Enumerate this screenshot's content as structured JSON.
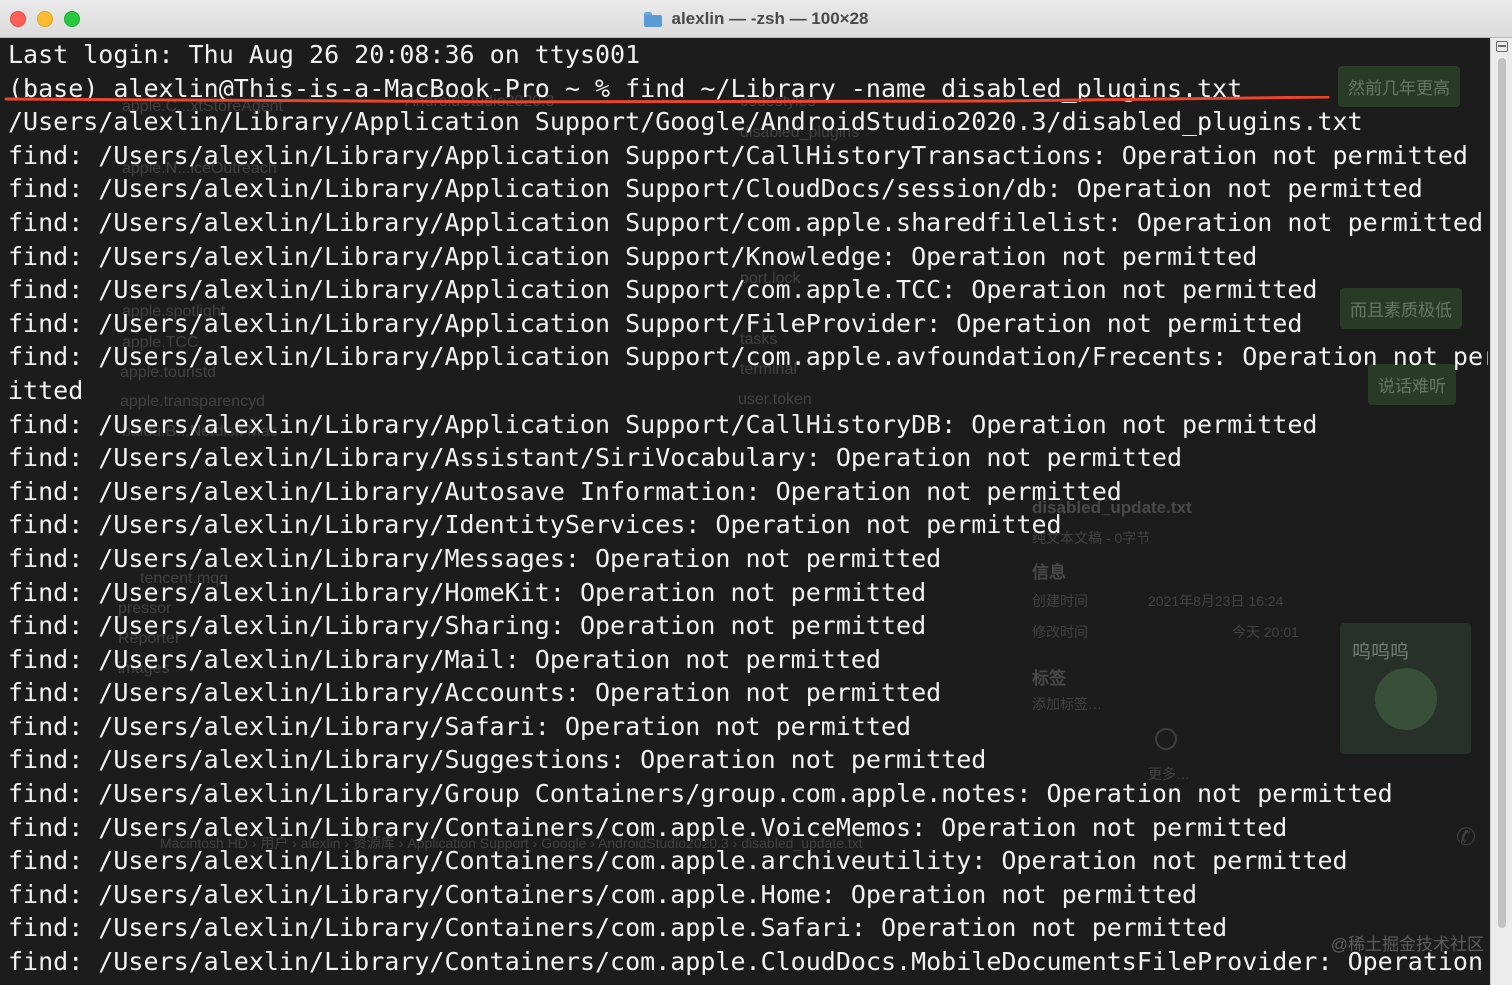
{
  "window": {
    "title": "alexlin — -zsh — 100×28",
    "folder_icon": "folder-icon"
  },
  "terminal": {
    "lines": [
      "Last login: Thu Aug 26 20:08:36 on ttys001",
      "(base) alexlin@This-is-a-MacBook-Pro ~ % find ~/Library -name disabled_plugins.txt",
      "/Users/alexlin/Library/Application Support/Google/AndroidStudio2020.3/disabled_plugins.txt",
      "find: /Users/alexlin/Library/Application Support/CallHistoryTransactions: Operation not permitted",
      "find: /Users/alexlin/Library/Application Support/CloudDocs/session/db: Operation not permitted",
      "find: /Users/alexlin/Library/Application Support/com.apple.sharedfilelist: Operation not permitted",
      "find: /Users/alexlin/Library/Application Support/Knowledge: Operation not permitted",
      "find: /Users/alexlin/Library/Application Support/com.apple.TCC: Operation not permitted",
      "find: /Users/alexlin/Library/Application Support/FileProvider: Operation not permitted",
      "find: /Users/alexlin/Library/Application Support/com.apple.avfoundation/Frecents: Operation not perm",
      "itted",
      "find: /Users/alexlin/Library/Application Support/CallHistoryDB: Operation not permitted",
      "find: /Users/alexlin/Library/Assistant/SiriVocabulary: Operation not permitted",
      "find: /Users/alexlin/Library/Autosave Information: Operation not permitted",
      "find: /Users/alexlin/Library/IdentityServices: Operation not permitted",
      "find: /Users/alexlin/Library/Messages: Operation not permitted",
      "find: /Users/alexlin/Library/HomeKit: Operation not permitted",
      "find: /Users/alexlin/Library/Sharing: Operation not permitted",
      "find: /Users/alexlin/Library/Mail: Operation not permitted",
      "find: /Users/alexlin/Library/Accounts: Operation not permitted",
      "find: /Users/alexlin/Library/Safari: Operation not permitted",
      "find: /Users/alexlin/Library/Suggestions: Operation not permitted",
      "find: /Users/alexlin/Library/Group Containers/group.com.apple.notes: Operation not permitted",
      "find: /Users/alexlin/Library/Containers/com.apple.VoiceMemos: Operation not permitted",
      "find: /Users/alexlin/Library/Containers/com.apple.archiveutility: Operation not permitted",
      "find: /Users/alexlin/Library/Containers/com.apple.Home: Operation not permitted",
      "find: /Users/alexlin/Library/Containers/com.apple.Safari: Operation not permitted",
      "find: /Users/alexlin/Library/Containers/com.apple.CloudDocs.MobileDocumentsFileProvider: Operation n"
    ],
    "annotation_color": "#e8452c"
  },
  "background": {
    "finder_items": [
      "apple.C...xtStoreAgent",
      "AndroidStudio2020.3",
      "codestyles",
      "disabled_plugins",
      "apple.N...iceOutreach",
      "apple.spotlight",
      "apple.TCC",
      "tasks",
      "terminal",
      "apple.touristd",
      "apple.transparencyd",
      "user.token",
      "baidu.B...Netdisk Mac",
      "tencent.mqq",
      "pressor",
      "Reporter",
      "images",
      "port.lock"
    ],
    "chat_bubbles": [
      "然前几年更高",
      "而且素质极低",
      "说话难听"
    ],
    "info_panel": {
      "file_name": "disabled_update.txt",
      "file_kind": "纯文本文稿 - 0字节",
      "section_info": "信息",
      "created_label": "创建时间",
      "created_value": "2021年8月23日 16:24",
      "modified_label": "修改时间",
      "modified_value": "今天 20:01",
      "tags_label": "标签",
      "add_tags": "添加标签…",
      "more": "更多…"
    },
    "path_bar": "Macintosh HD › 用户 › alexlin › 资源库 › Application Support › Google › AndroidStudio2020.3 › disabled_update.txt",
    "sticker_text": "呜呜呜",
    "watermark": "@稀土掘金技术社区"
  }
}
